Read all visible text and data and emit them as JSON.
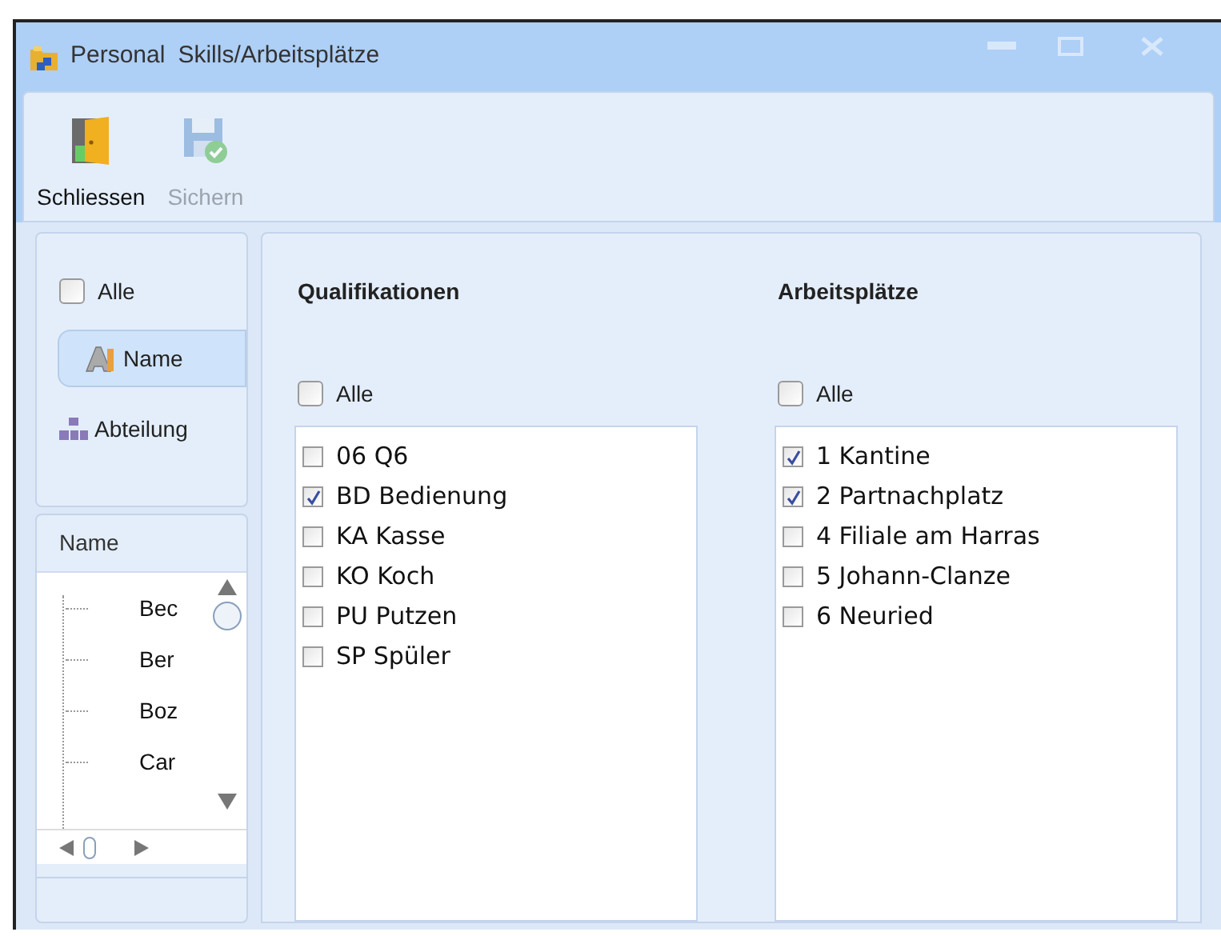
{
  "window": {
    "app": "Personal",
    "title": "Skills/Arbeitsplätze"
  },
  "toolbar": [
    {
      "label": "Schliessen",
      "disabled": false,
      "kind": "door"
    },
    {
      "label": "Sichern",
      "disabled": true,
      "kind": "save"
    }
  ],
  "sidebar": {
    "all": {
      "label": "Alle",
      "checked": false
    },
    "group_by": [
      {
        "label": "Name",
        "selected": true,
        "kind": "name"
      },
      {
        "label": "Abteilung",
        "selected": false,
        "kind": "org"
      }
    ],
    "tree": {
      "column": "Name",
      "items": [
        {
          "label": "Bec"
        },
        {
          "label": "Ber"
        },
        {
          "label": "Boz"
        },
        {
          "label": "Car"
        }
      ]
    }
  },
  "lists": [
    {
      "title": "Qualifikationen",
      "all": {
        "label": "Alle",
        "checked": false
      },
      "items": [
        {
          "label": "06 Q6",
          "checked": false
        },
        {
          "label": "BD Bedienung",
          "checked": true
        },
        {
          "label": "KA Kasse",
          "checked": false
        },
        {
          "label": "KO Koch",
          "checked": false
        },
        {
          "label": "PU Putzen",
          "checked": false
        },
        {
          "label": "SP Spüler",
          "checked": false
        }
      ]
    },
    {
      "title": "Arbeitsplätze",
      "all": {
        "label": "Alle",
        "checked": false
      },
      "items": [
        {
          "label": "1 Kantine",
          "checked": true
        },
        {
          "label": "2 Partnachplatz",
          "checked": true
        },
        {
          "label": "4 Filiale am Harras",
          "checked": false
        },
        {
          "label": "5 Johann-Clanze",
          "checked": false
        },
        {
          "label": "6 Neuried",
          "checked": false
        }
      ]
    }
  ]
}
